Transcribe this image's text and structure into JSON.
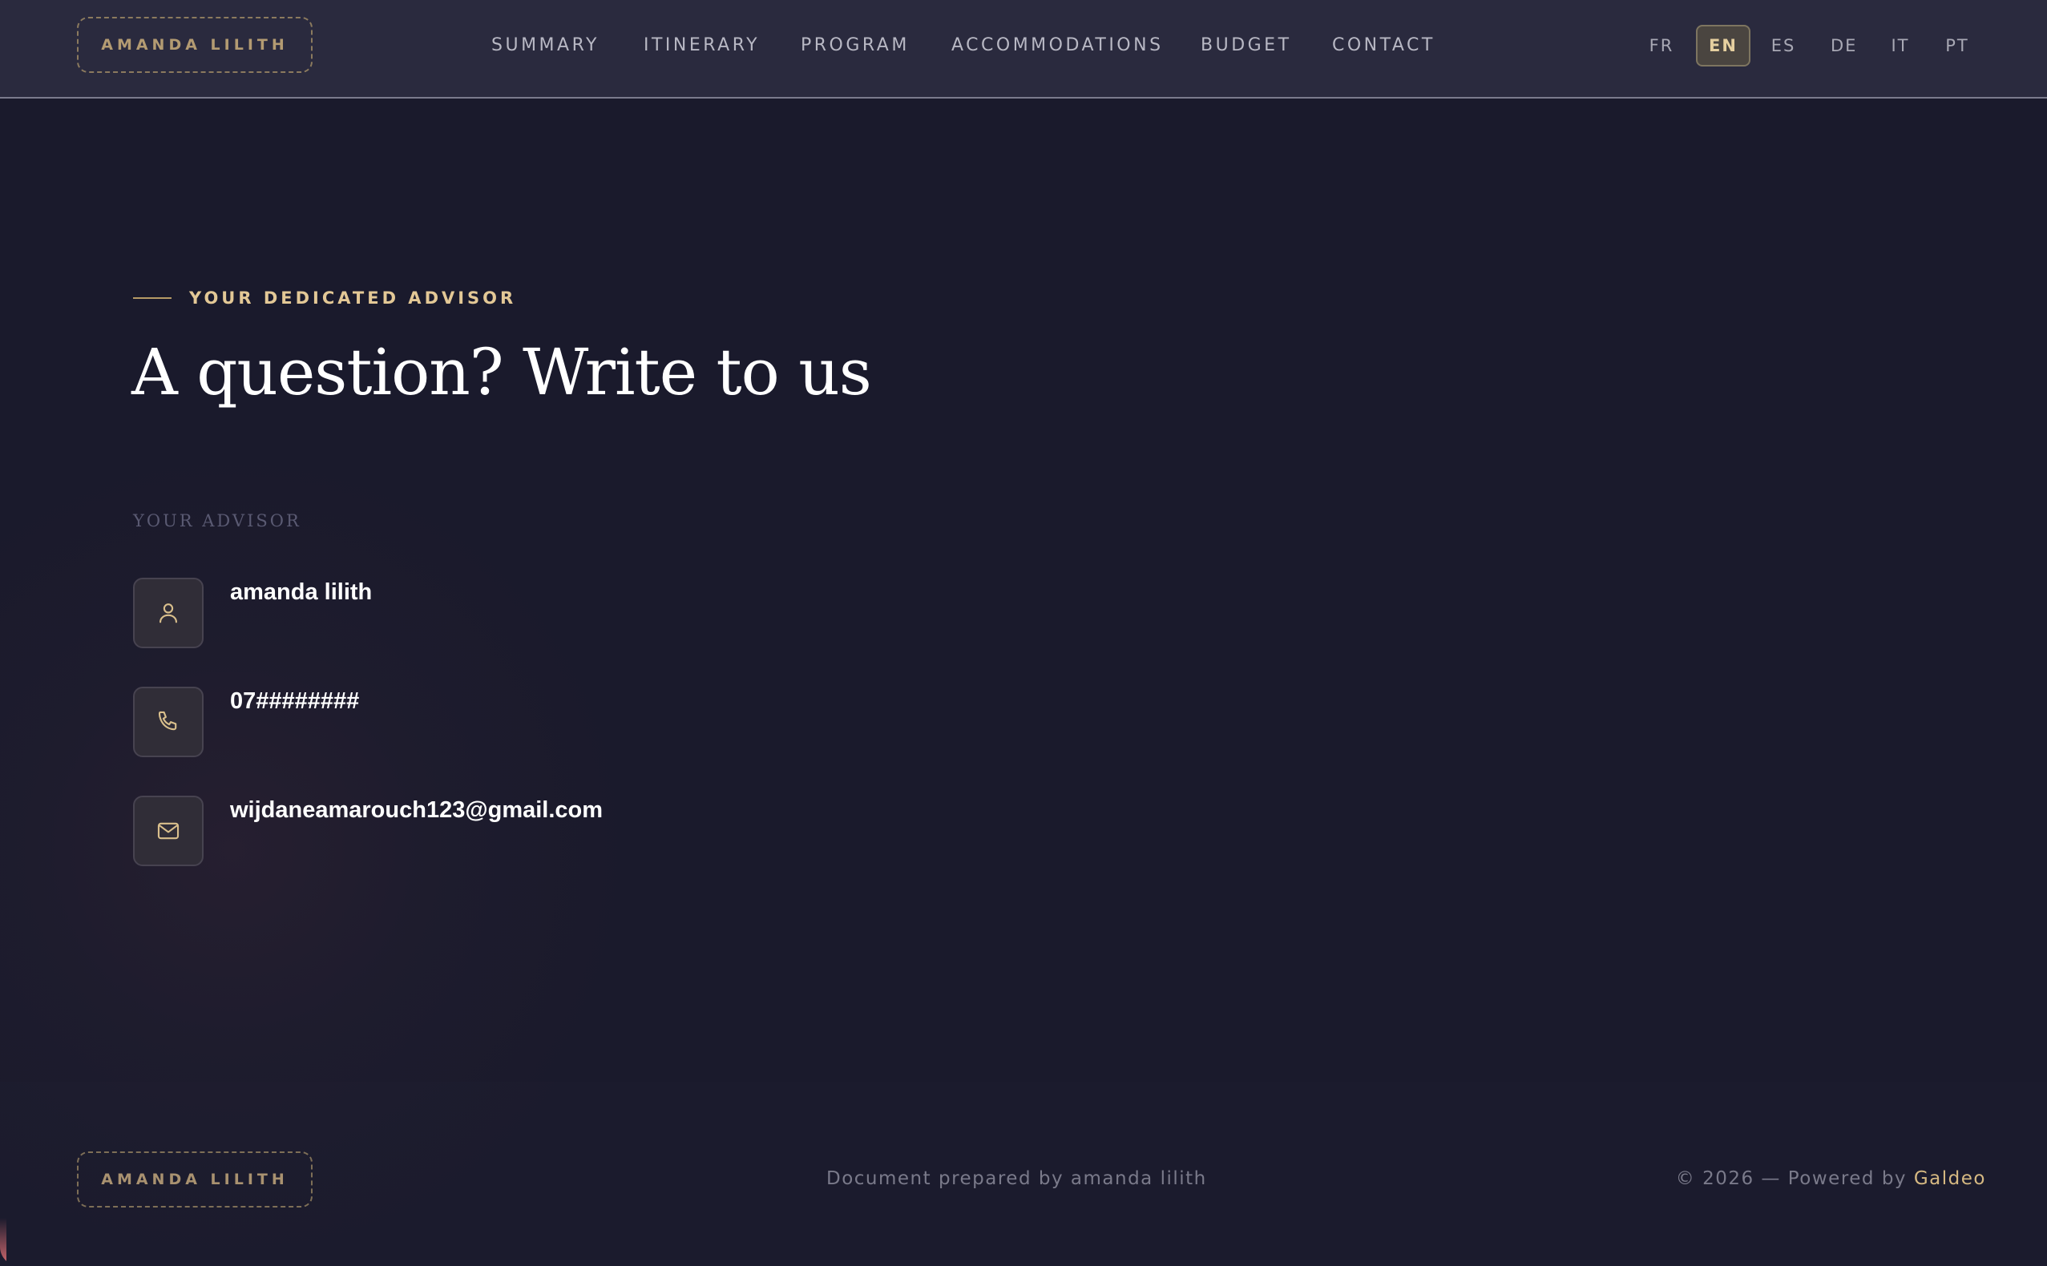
{
  "header": {
    "brand": "AMANDA LILITH",
    "nav": [
      {
        "label": "SUMMARY"
      },
      {
        "label": "ITINERARY"
      },
      {
        "label": "PROGRAM"
      },
      {
        "label": "ACCOMMODATIONS"
      },
      {
        "label": "BUDGET"
      },
      {
        "label": "CONTACT"
      }
    ],
    "languages": [
      {
        "code": "FR",
        "active": false
      },
      {
        "code": "EN",
        "active": true
      },
      {
        "code": "ES",
        "active": false
      },
      {
        "code": "DE",
        "active": false
      },
      {
        "code": "IT",
        "active": false
      },
      {
        "code": "PT",
        "active": false
      }
    ]
  },
  "main": {
    "eyebrow": "YOUR DEDICATED ADVISOR",
    "heading": "A question? Write to us",
    "section_label": "YOUR ADVISOR",
    "contacts": [
      {
        "icon": "user-icon",
        "value": "amanda lilith"
      },
      {
        "icon": "phone-icon",
        "value": "07########"
      },
      {
        "icon": "mail-icon",
        "value": "wijdaneamarouch123@gmail.com"
      }
    ]
  },
  "footer": {
    "brand": "AMANDA LILITH",
    "prepared": "Document prepared by amanda lilith",
    "copyright_prefix": "© 2026 — Powered by ",
    "powered_by": "Galdeo"
  },
  "colors": {
    "background": "#1b1b2d",
    "header_bg": "#2a2a3e",
    "accent_gold": "#e3c896",
    "text_muted": "#7a7a8a"
  }
}
